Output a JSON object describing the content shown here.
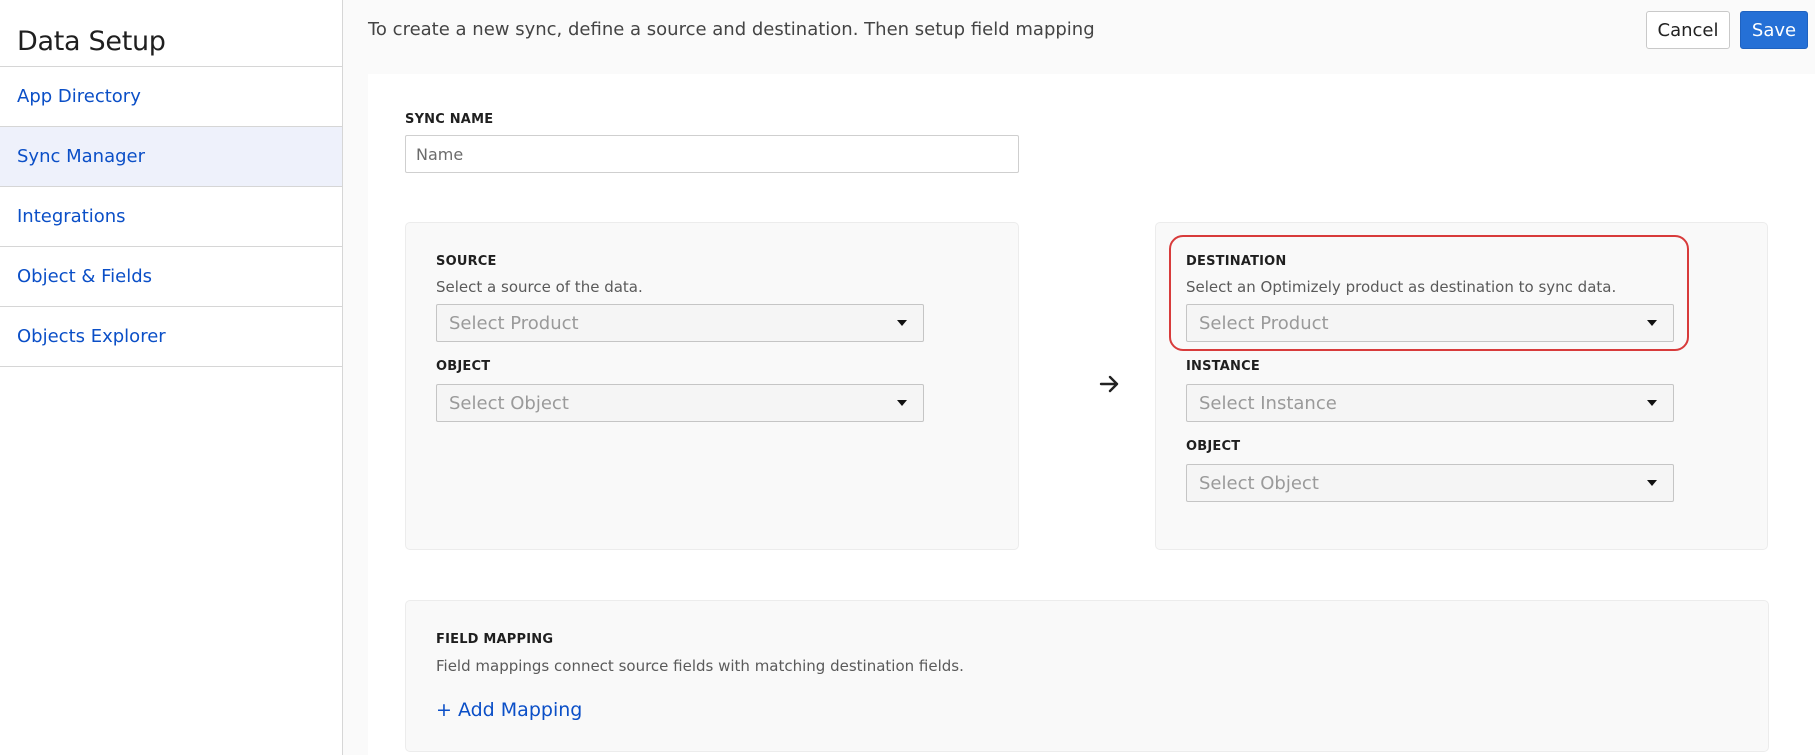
{
  "sidebar": {
    "title": "Data Setup",
    "items": [
      {
        "label": "App Directory"
      },
      {
        "label": "Sync Manager"
      },
      {
        "label": "Integrations"
      },
      {
        "label": "Object & Fields"
      },
      {
        "label": "Objects Explorer"
      }
    ],
    "active_item": "Sync Manager"
  },
  "header": {
    "instructions": "To create a new sync, define a source and destination. Then setup field mapping",
    "cancel_label": "Cancel",
    "save_label": "Save"
  },
  "sync_name": {
    "label": "SYNC NAME",
    "placeholder": "Name",
    "value": ""
  },
  "source": {
    "label": "SOURCE",
    "description": "Select a source of the data.",
    "product_select": "Select Product",
    "object_label": "OBJECT",
    "object_select": "Select Object"
  },
  "arrow_icon": "arrow-right-icon",
  "destination": {
    "label": "DESTINATION",
    "description": "Select an Optimizely product as destination to sync data.",
    "product_select": "Select Product",
    "instance_label": "INSTANCE",
    "instance_select": "Select Instance",
    "object_label": "OBJECT",
    "object_select": "Select Object"
  },
  "field_mapping": {
    "label": "FIELD MAPPING",
    "description": "Field mappings connect source fields with matching destination fields.",
    "add_label": "+ Add Mapping"
  },
  "colors": {
    "accent": "#2570d6",
    "link": "#0b4fc7",
    "highlight": "#d83b3b"
  }
}
